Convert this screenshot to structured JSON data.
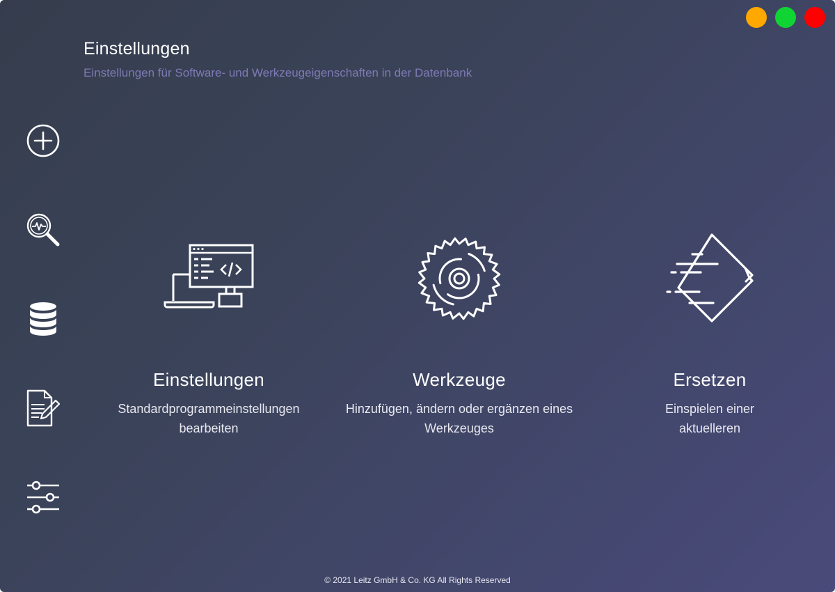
{
  "colors": {
    "minimize": "#ffa800",
    "maximize": "#10d433",
    "close": "#ff0000",
    "subtitle": "#7e7ab3"
  },
  "header": {
    "title": "Einstellungen",
    "subtitle": "Einstellungen für Software- und Werkzeugeigenschaften in der Datenbank"
  },
  "sidebar": {
    "items": [
      {
        "icon": "add-circle-icon"
      },
      {
        "icon": "search-analysis-icon"
      },
      {
        "icon": "database-icon"
      },
      {
        "icon": "document-edit-icon"
      },
      {
        "icon": "sliders-icon"
      }
    ]
  },
  "cards": [
    {
      "icon": "code-devices-icon",
      "title": "Einstellungen",
      "desc_line1": "Standardprogrammeinstellungen",
      "desc_line2": "bearbeiten"
    },
    {
      "icon": "saw-blade-icon",
      "title": "Werkzeuge",
      "desc_line1": "Hinzufügen, ändern oder ergänzen eines",
      "desc_line2": "Werkzeuges"
    },
    {
      "icon": "fast-document-icon",
      "title": "Ersetzen",
      "desc_line1": "Einspielen einer",
      "desc_line2": "aktuelleren"
    }
  ],
  "footer": {
    "text": "© 2021 Leitz GmbH & Co. KG All Rights Reserved"
  }
}
